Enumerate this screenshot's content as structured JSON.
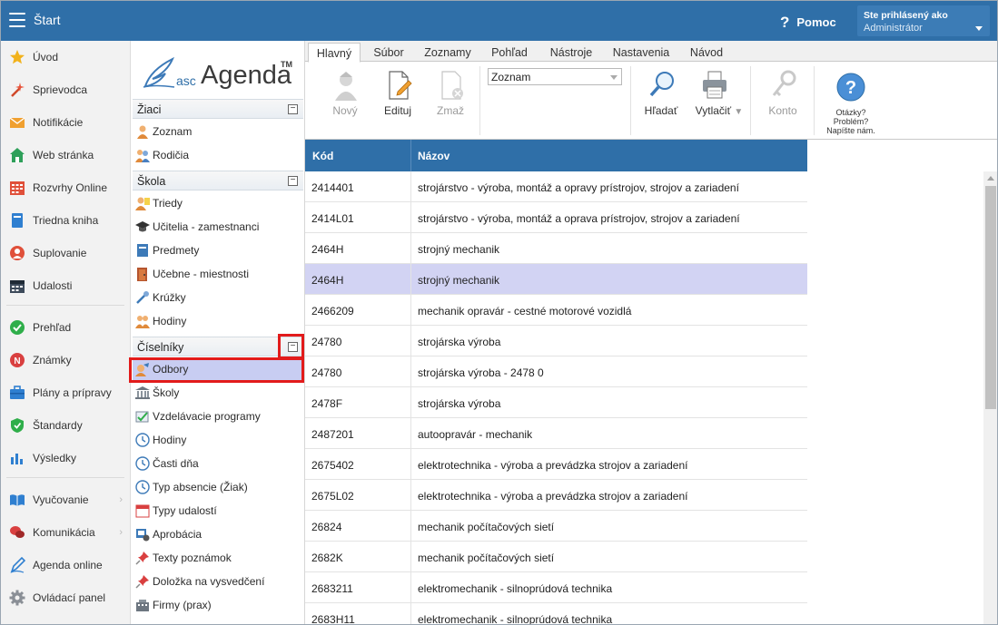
{
  "topbar": {
    "title": "Štart",
    "help_label": "Pomoc",
    "help_icon": "question-icon",
    "user_caption": "Ste prihlásený ako",
    "user_name": "Administrátor",
    "accent": "#2f6fa8"
  },
  "mainnav": {
    "items": [
      {
        "label": "Úvod",
        "icon": "star-icon"
      },
      {
        "label": "Sprievodca",
        "icon": "magic-wand-icon"
      },
      {
        "label": "Notifikácie",
        "icon": "envelope-icon"
      },
      {
        "label": "Web stránka",
        "icon": "home-icon"
      },
      {
        "label": "Rozvrhy Online",
        "icon": "calendar-grid-icon"
      },
      {
        "label": "Triedna kniha",
        "icon": "book-icon"
      },
      {
        "label": "Suplovanie",
        "icon": "substitute-icon"
      },
      {
        "label": "Udalosti",
        "icon": "calendar-icon"
      },
      {
        "label": "Prehľad",
        "icon": "check-circle-icon"
      },
      {
        "label": "Známky",
        "icon": "grades-icon"
      },
      {
        "label": "Plány a prípravy",
        "icon": "briefcase-icon"
      },
      {
        "label": "Štandardy",
        "icon": "shield-check-icon"
      },
      {
        "label": "Výsledky",
        "icon": "bar-chart-icon"
      },
      {
        "label": "Vyučovanie",
        "icon": "open-book-icon"
      },
      {
        "label": "Komunikácia",
        "icon": "chat-icon"
      },
      {
        "label": "Agenda online",
        "icon": "pen-icon"
      },
      {
        "label": "Ovládací panel",
        "icon": "gear-icon"
      }
    ]
  },
  "sidepanel": {
    "logo_asc": "asc",
    "logo_agenda": "Agenda",
    "logo_tm": "TM",
    "sections": [
      {
        "title": "Žiaci",
        "items": [
          {
            "label": "Zoznam",
            "icon": "student-icon"
          },
          {
            "label": "Rodičia",
            "icon": "parents-icon"
          }
        ]
      },
      {
        "title": "Škola",
        "items": [
          {
            "label": "Triedy",
            "icon": "class-icon"
          },
          {
            "label": "Učitelia - zamestnanci",
            "icon": "graduation-cap-icon"
          },
          {
            "label": "Predmety",
            "icon": "subject-book-icon"
          },
          {
            "label": "Učebne - miestnosti",
            "icon": "door-icon"
          },
          {
            "label": "Krúžky",
            "icon": "club-icon"
          },
          {
            "label": "Hodiny",
            "icon": "lessons-icon"
          }
        ]
      },
      {
        "title": "Číselníky",
        "items": [
          {
            "label": "Odbory",
            "icon": "field-icon"
          },
          {
            "label": "Školy",
            "icon": "school-building-icon"
          },
          {
            "label": "Vzdelávacie programy",
            "icon": "program-icon"
          },
          {
            "label": "Hodiny",
            "icon": "clock-icon"
          },
          {
            "label": "Časti dňa",
            "icon": "clock-icon"
          },
          {
            "label": "Typ absencie (Žiak)",
            "icon": "clock-icon"
          },
          {
            "label": "Typy udalostí",
            "icon": "calendar-icon"
          },
          {
            "label": "Aprobácia",
            "icon": "approval-icon"
          },
          {
            "label": "Texty poznámok",
            "icon": "pin-icon"
          },
          {
            "label": "Doložka na vysvedčení",
            "icon": "pin-icon"
          },
          {
            "label": "Firmy (prax)",
            "icon": "company-icon"
          }
        ]
      }
    ]
  },
  "ribbon": {
    "tabs": [
      "Hlavný",
      "Súbor",
      "Zoznamy",
      "Pohľad",
      "Nástroje",
      "Nastavenia",
      "Návod"
    ],
    "active_tab": "Hlavný",
    "buttons": {
      "new": "Nový",
      "edit": "Edituj",
      "delete": "Zmaž",
      "search": "Hľadať",
      "print": "Vytlačiť",
      "account": "Konto"
    },
    "view_select": "Zoznam",
    "help_lines": [
      "Otázky?",
      "Problém?",
      "Napíšte nám."
    ]
  },
  "table": {
    "columns": [
      "Kód",
      "Názov"
    ],
    "selected_row": 3,
    "rows": [
      {
        "code": "2414401",
        "name": "strojárstvo - výroba, montáž a opravy prístrojov, strojov a zariadení"
      },
      {
        "code": "2414L01",
        "name": "strojárstvo - výroba, montáž a oprava prístrojov, strojov a zariadení"
      },
      {
        "code": "2464H",
        "name": "strojný mechanik"
      },
      {
        "code": "2464H",
        "name": "strojný mechanik"
      },
      {
        "code": "2466209",
        "name": "mechanik opravár - cestné motorové vozidlá"
      },
      {
        "code": "24780",
        "name": "strojárska výroba"
      },
      {
        "code": "24780",
        "name": "strojárska výroba - 2478 0"
      },
      {
        "code": "2478F",
        "name": "strojárska výroba"
      },
      {
        "code": "2487201",
        "name": "autoopravár - mechanik"
      },
      {
        "code": "2675402",
        "name": "elektrotechnika - výroba a prevádzka strojov a zariadení"
      },
      {
        "code": "2675L02",
        "name": "elektrotechnika - výroba a prevádzka strojov a zariadení"
      },
      {
        "code": "26824",
        "name": "mechanik počítačových sietí"
      },
      {
        "code": "2682K",
        "name": "mechanik počítačových sietí"
      },
      {
        "code": "2683211",
        "name": "elektromechanik - silnoprúdová technika"
      },
      {
        "code": "2683H11",
        "name": "elektromechanik - silnoprúdová technika"
      }
    ]
  }
}
